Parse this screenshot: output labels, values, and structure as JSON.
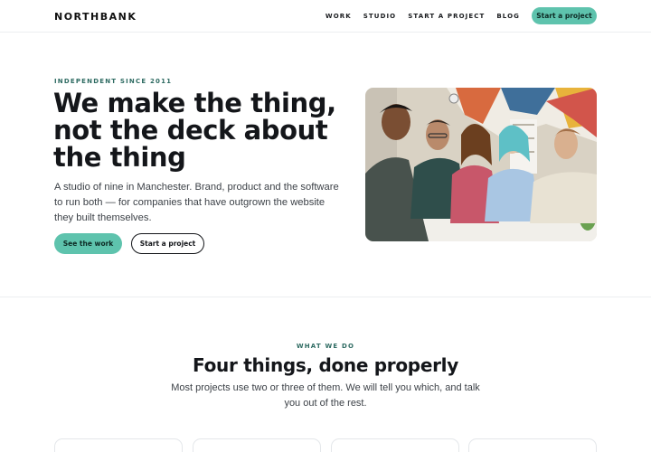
{
  "brand": {
    "name": "NORTHBANK"
  },
  "nav": {
    "links": [
      "WORK",
      "STUDIO",
      "START A PROJECT",
      "BLOG"
    ],
    "cta": "Start a project"
  },
  "hero": {
    "eyebrow": "INDEPENDENT SINCE 2011",
    "title": "We make the thing, not the deck about the thing",
    "body": "A studio of nine in Manchester. Brand, product and the software to run both — for companies that have outgrown the website they built themselves.",
    "primary_button": "See the work",
    "secondary_button": "Start a project",
    "image_alt": "team-collaborating-photo"
  },
  "services": {
    "eyebrow": "WHAT WE DO",
    "title": "Four things, done properly",
    "body": "Most projects use two or three of them. We will tell you which, and talk you out of the rest."
  },
  "colors": {
    "accent": "#5ec3ad",
    "eyebrow": "#2e6b62",
    "text": "#14161a"
  }
}
